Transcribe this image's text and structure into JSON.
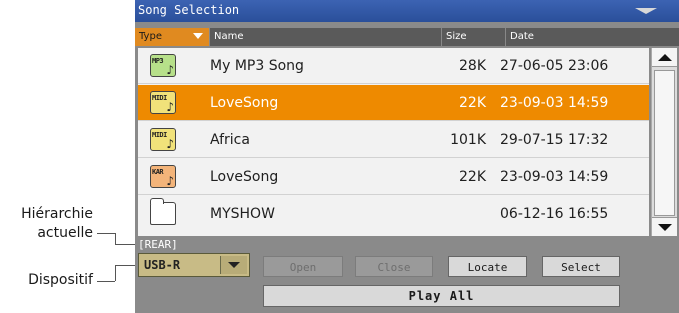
{
  "window": {
    "title": "Song Selection"
  },
  "columns": {
    "type": "Type",
    "name": "Name",
    "size": "Size",
    "date": "Date"
  },
  "files": [
    {
      "icon_tag": "MP3",
      "icon": "mp3-file-icon",
      "name": "My MP3 Song",
      "size": "28K",
      "date": "27-06-05 23:06",
      "selected": false
    },
    {
      "icon_tag": "MIDI",
      "icon": "midi-file-icon",
      "name": "LoveSong",
      "size": "22K",
      "date": "23-09-03 14:59",
      "selected": true
    },
    {
      "icon_tag": "MIDI",
      "icon": "midi-file-icon",
      "name": "Africa",
      "size": "101K",
      "date": "29-07-15 17:32",
      "selected": false
    },
    {
      "icon_tag": "KAR",
      "icon": "karaoke-file-icon",
      "name": "LoveSong",
      "size": "22K",
      "date": "23-09-03 14:59",
      "selected": false
    },
    {
      "icon_tag": "",
      "icon": "folder-icon",
      "name": "MYSHOW",
      "size": "",
      "date": "06-12-16 16:55",
      "selected": false
    }
  ],
  "path": "[REAR]",
  "device": {
    "value": "USB-R"
  },
  "buttons": {
    "open": "Open",
    "close": "Close",
    "locate": "Locate",
    "select": "Select",
    "play_all": "Play All"
  },
  "callouts": {
    "hierarchy_line1": "Hiérarchie",
    "hierarchy_line2": "actuelle",
    "device": "Dispositif"
  },
  "colors": {
    "title_bar": "#2f57a6",
    "selected_row": "#ee8a00",
    "type_header": "#e08a20",
    "device_select": "#c8bb86"
  }
}
